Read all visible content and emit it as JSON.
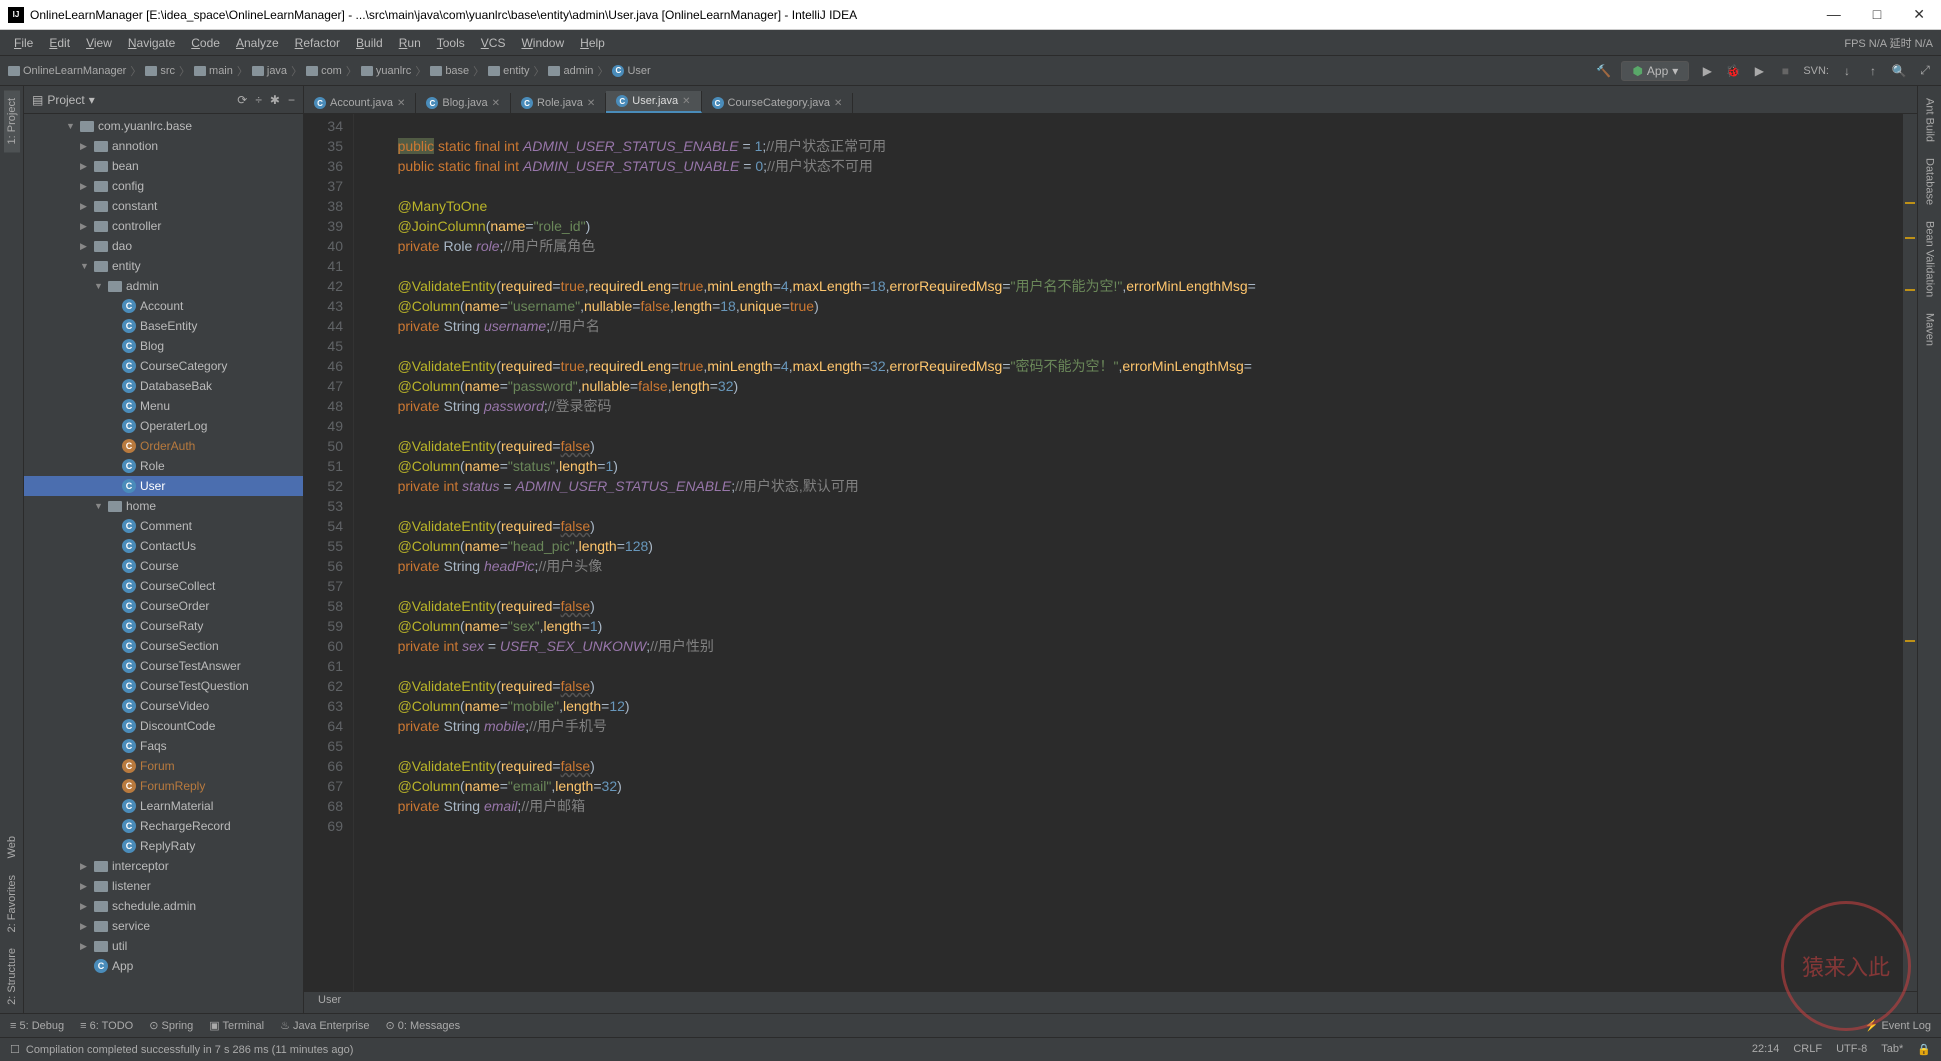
{
  "title": "OnlineLearnManager [E:\\idea_space\\OnlineLearnManager] - ...\\src\\main\\java\\com\\yuanlrc\\base\\entity\\admin\\User.java [OnlineLearnManager] - IntelliJ IDEA",
  "menus": [
    "File",
    "Edit",
    "View",
    "Navigate",
    "Code",
    "Analyze",
    "Refactor",
    "Build",
    "Run",
    "Tools",
    "VCS",
    "Window",
    "Help"
  ],
  "fps_info": "FPS  N/A  延时  N/A",
  "nav_right": {
    "run_config": "App",
    "svn": "SVN:"
  },
  "breadcrumb": [
    "OnlineLearnManager",
    "src",
    "main",
    "java",
    "com",
    "yuanlrc",
    "base",
    "entity",
    "admin",
    "User"
  ],
  "sidebar": {
    "title": "Project",
    "tools": [
      "⟳",
      "÷",
      "✱",
      "−"
    ]
  },
  "tree": [
    {
      "d": 3,
      "a": "▼",
      "ico": "pkg",
      "t": "com.yuanlrc.base"
    },
    {
      "d": 4,
      "a": "▶",
      "ico": "pkg",
      "t": "annotion"
    },
    {
      "d": 4,
      "a": "▶",
      "ico": "pkg",
      "t": "bean"
    },
    {
      "d": 4,
      "a": "▶",
      "ico": "pkg",
      "t": "config"
    },
    {
      "d": 4,
      "a": "▶",
      "ico": "pkg",
      "t": "constant"
    },
    {
      "d": 4,
      "a": "▶",
      "ico": "pkg",
      "t": "controller"
    },
    {
      "d": 4,
      "a": "▶",
      "ico": "pkg",
      "t": "dao"
    },
    {
      "d": 4,
      "a": "▼",
      "ico": "pkg",
      "t": "entity"
    },
    {
      "d": 5,
      "a": "▼",
      "ico": "pkg",
      "t": "admin"
    },
    {
      "d": 6,
      "a": "",
      "ico": "cls",
      "t": "Account"
    },
    {
      "d": 6,
      "a": "",
      "ico": "cls",
      "t": "BaseEntity"
    },
    {
      "d": 6,
      "a": "",
      "ico": "cls",
      "t": "Blog"
    },
    {
      "d": 6,
      "a": "",
      "ico": "cls",
      "t": "CourseCategory"
    },
    {
      "d": 6,
      "a": "",
      "ico": "cls",
      "t": "DatabaseBak"
    },
    {
      "d": 6,
      "a": "",
      "ico": "cls",
      "t": "Menu"
    },
    {
      "d": 6,
      "a": "",
      "ico": "cls",
      "t": "OperaterLog"
    },
    {
      "d": 6,
      "a": "",
      "ico": "clso",
      "t": "OrderAuth"
    },
    {
      "d": 6,
      "a": "",
      "ico": "cls",
      "t": "Role"
    },
    {
      "d": 6,
      "a": "",
      "ico": "cls",
      "t": "User",
      "sel": true
    },
    {
      "d": 5,
      "a": "▼",
      "ico": "pkg",
      "t": "home"
    },
    {
      "d": 6,
      "a": "",
      "ico": "cls",
      "t": "Comment"
    },
    {
      "d": 6,
      "a": "",
      "ico": "cls",
      "t": "ContactUs"
    },
    {
      "d": 6,
      "a": "",
      "ico": "cls",
      "t": "Course"
    },
    {
      "d": 6,
      "a": "",
      "ico": "cls",
      "t": "CourseCollect"
    },
    {
      "d": 6,
      "a": "",
      "ico": "cls",
      "t": "CourseOrder"
    },
    {
      "d": 6,
      "a": "",
      "ico": "cls",
      "t": "CourseRaty"
    },
    {
      "d": 6,
      "a": "",
      "ico": "cls",
      "t": "CourseSection"
    },
    {
      "d": 6,
      "a": "",
      "ico": "cls",
      "t": "CourseTestAnswer"
    },
    {
      "d": 6,
      "a": "",
      "ico": "cls",
      "t": "CourseTestQuestion"
    },
    {
      "d": 6,
      "a": "",
      "ico": "cls",
      "t": "CourseVideo"
    },
    {
      "d": 6,
      "a": "",
      "ico": "cls",
      "t": "DiscountCode"
    },
    {
      "d": 6,
      "a": "",
      "ico": "cls",
      "t": "Faqs"
    },
    {
      "d": 6,
      "a": "",
      "ico": "clso",
      "t": "Forum"
    },
    {
      "d": 6,
      "a": "",
      "ico": "clso",
      "t": "ForumReply"
    },
    {
      "d": 6,
      "a": "",
      "ico": "cls",
      "t": "LearnMaterial"
    },
    {
      "d": 6,
      "a": "",
      "ico": "cls",
      "t": "RechargeRecord"
    },
    {
      "d": 6,
      "a": "",
      "ico": "cls",
      "t": "ReplyRaty"
    },
    {
      "d": 4,
      "a": "▶",
      "ico": "pkg",
      "t": "interceptor"
    },
    {
      "d": 4,
      "a": "▶",
      "ico": "pkg",
      "t": "listener"
    },
    {
      "d": 4,
      "a": "▶",
      "ico": "pkg",
      "t": "schedule.admin"
    },
    {
      "d": 4,
      "a": "▶",
      "ico": "pkg",
      "t": "service"
    },
    {
      "d": 4,
      "a": "▶",
      "ico": "pkg",
      "t": "util"
    },
    {
      "d": 4,
      "a": "",
      "ico": "cls",
      "t": "App"
    }
  ],
  "tabs": [
    {
      "label": "Account.java",
      "active": false
    },
    {
      "label": "Blog.java",
      "active": false
    },
    {
      "label": "Role.java",
      "active": false
    },
    {
      "label": "User.java",
      "active": true
    },
    {
      "label": "CourseCategory.java",
      "active": false
    }
  ],
  "line_start": 34,
  "line_end": 69,
  "code_lines": [
    "",
    "<kw-hl>public</kw-hl> <kw>static final int</kw> <fld>ADMIN_USER_STATUS_ENABLE</fld> = <num>1</num>;<cmt>//用户状态正常可用</cmt>",
    "<kw>public static final int</kw> <fld>ADMIN_USER_STATUS_UNABLE</fld> = <num>0</num>;<cmt>//用户状态不可用</cmt>",
    "",
    "<ann>@ManyToOne</ann>",
    "<ann>@JoinColumn</ann>(<mtd>name</mtd>=<str>\"role_id\"</str>)",
    "<kw>private</kw> Role <fld>role</fld>;<cmt>//用户所属角色</cmt>",
    "",
    "<ann>@ValidateEntity</ann>(<mtd>required</mtd>=<kw>true</kw>,<mtd>requiredLeng</mtd>=<kw>true</kw>,<mtd>minLength</mtd>=<num>4</num>,<mtd>maxLength</mtd>=<num>18</num>,<mtd>errorRequiredMsg</mtd>=<str>\"用户名不能为空!\"</str>,<mtd>errorMinLengthMsg</mtd>=",
    "<ann>@Column</ann>(<mtd>name</mtd>=<str>\"username\"</str>,<mtd>nullable</mtd>=<kw>false</kw>,<mtd>length</mtd>=<num>18</num>,<mtd>unique</mtd>=<kw>true</kw>)",
    "<kw>private</kw> String <fld>username</fld>;<cmt>//用户名</cmt>",
    "",
    "<ann>@ValidateEntity</ann>(<mtd>required</mtd>=<kw>true</kw>,<mtd>requiredLeng</mtd>=<kw>true</kw>,<mtd>minLength</mtd>=<num>4</num>,<mtd>maxLength</mtd>=<num>32</num>,<mtd>errorRequiredMsg</mtd>=<str>\"密码不能为空！\"</str>,<mtd>errorMinLengthMsg</mtd>=",
    "<ann>@Column</ann>(<mtd>name</mtd>=<str>\"password\"</str>,<mtd>nullable</mtd>=<kw>false</kw>,<mtd>length</mtd>=<num>32</num>)",
    "<kw>private</kw> String <fld>password</fld>;<cmt>//登录密码</cmt>",
    "",
    "<ann>@ValidateEntity</ann>(<mtd>required</mtd>=<kw><und>false</und></kw>)",
    "<ann>@Column</ann>(<mtd>name</mtd>=<str>\"status\"</str>,<mtd>length</mtd>=<num>1</num>)",
    "<kw>private int</kw> <fld>status</fld> = <fld>ADMIN_USER_STATUS_ENABLE</fld>;<cmt>//用户状态,默认可用</cmt>",
    "",
    "<ann>@ValidateEntity</ann>(<mtd>required</mtd>=<kw><und>false</und></kw>)",
    "<ann>@Column</ann>(<mtd>name</mtd>=<str>\"head_pic\"</str>,<mtd>length</mtd>=<num>128</num>)",
    "<kw>private</kw> String <fld>headPic</fld>;<cmt>//用户头像</cmt>",
    "",
    "<ann>@ValidateEntity</ann>(<mtd>required</mtd>=<kw><und>false</und></kw>)",
    "<ann>@Column</ann>(<mtd>name</mtd>=<str>\"sex\"</str>,<mtd>length</mtd>=<num>1</num>)",
    "<kw>private int</kw> <fld>sex</fld> = <fld>USER_SEX_UNKONW</fld>;<cmt>//用户性别</cmt>",
    "",
    "<ann>@ValidateEntity</ann>(<mtd>required</mtd>=<kw><und>false</und></kw>)",
    "<ann>@Column</ann>(<mtd>name</mtd>=<str>\"mobile\"</str>,<mtd>length</mtd>=<num>12</num>)",
    "<kw>private</kw> String <fld>mobile</fld>;<cmt>//用户手机号</cmt>",
    "",
    "<ann>@ValidateEntity</ann>(<mtd>required</mtd>=<kw><und>false</und></kw>)",
    "<ann>@Column</ann>(<mtd>name</mtd>=<str>\"email\"</str>,<mtd>length</mtd>=<num>32</num>)",
    "<kw>private</kw> String <fld>email</fld>;<cmt>//用户邮箱</cmt>",
    ""
  ],
  "editor_crumb": "User",
  "left_tools": [
    "1: Project"
  ],
  "left_tools_bottom": [
    "Web",
    "2: Favorites",
    "2: Structure"
  ],
  "right_tools": [
    "Ant Build",
    "Database",
    "Bean Validation",
    "Maven"
  ],
  "bottom_tools": [
    "≡ 5: Debug",
    "≡ 6: TODO",
    "⊙ Spring",
    "▣ Terminal",
    "♨ Java Enterprise",
    "⊙ 0: Messages"
  ],
  "bottom_right": "⚡ Event Log",
  "status": {
    "msg": "Compilation completed successfully in 7 s 286 ms (11 minutes ago)",
    "pos": "22:14",
    "crlf": "CRLF",
    "enc": "UTF-8",
    "tab": "Tab*",
    "lock": "🔒"
  },
  "watermark": "猿来入此"
}
